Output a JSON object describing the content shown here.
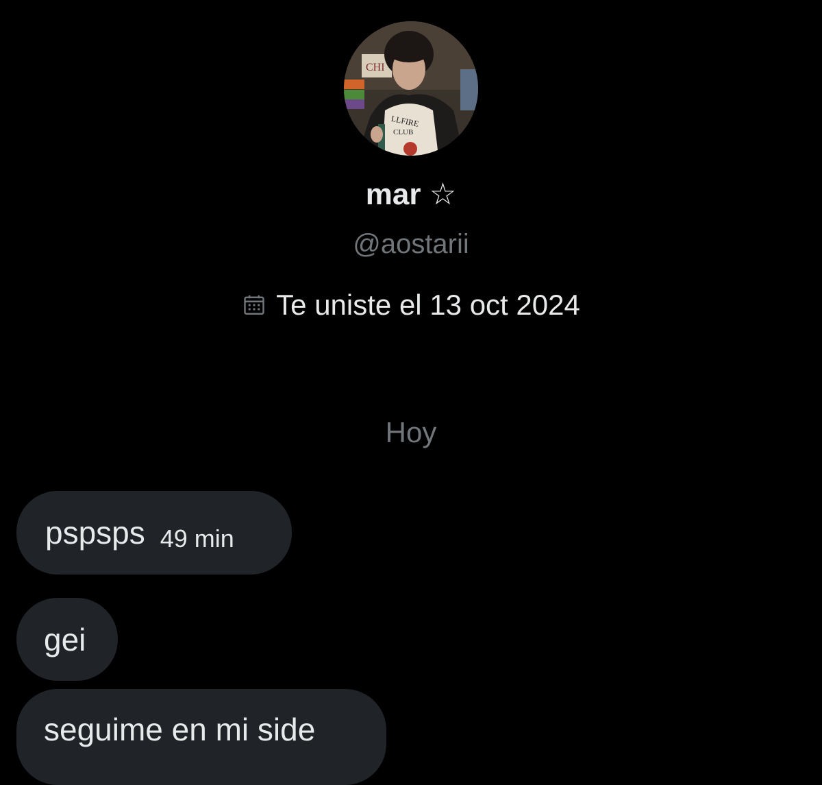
{
  "profile": {
    "display_name": "mar ☆",
    "handle": "@aostarii",
    "joined": "Te uniste el 13 oct 2024",
    "avatar_shirt_text_line1": "LLFIRE",
    "avatar_shirt_text_line2": "CLUB",
    "avatar_sign_text": "CHI"
  },
  "conversation": {
    "date_separator": "Hoy",
    "messages": [
      {
        "text": "pspsps",
        "time": "49 min"
      },
      {
        "text": "gei"
      },
      {
        "text": "seguime en mi side"
      }
    ]
  },
  "colors": {
    "background": "#000000",
    "bubble": "#202327",
    "primary_text": "#e7e9ea",
    "secondary_text": "#71767b"
  }
}
